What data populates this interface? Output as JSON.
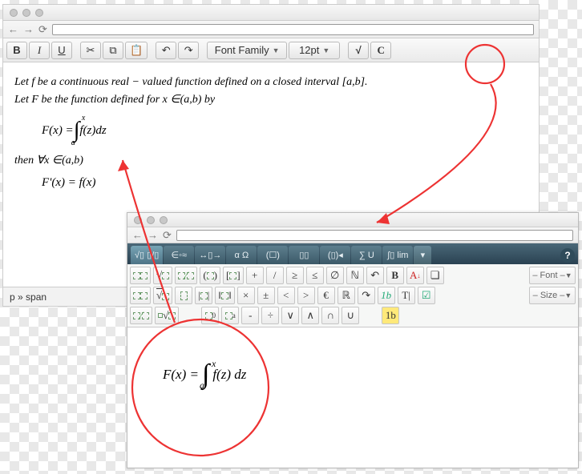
{
  "editor": {
    "toolbar": {
      "bold": "B",
      "italic": "I",
      "underline": "U",
      "font_family_label": "Font Family",
      "font_size_label": "12pt",
      "math_label": "√",
      "clear_label": "C"
    },
    "content": {
      "line1": "Let f be a continuous real − valued function defined on a closed interval [a,b].",
      "line2": "Let F be the function defined for x ∈(a,b) by",
      "eq_lhs": "F(x) =",
      "eq_int_lower": "a",
      "eq_int_upper": "x",
      "eq_rhs": "f(z)dz",
      "line3": "then  ∀x ∈(a,b)",
      "eq2": "F'(x) = f(x)"
    },
    "statusbar": "p » span"
  },
  "math_editor": {
    "tabs": {
      "sqrt_frac": "√▯ ▯/▯",
      "elements": "∈◦≈",
      "arrows": "↔▯→",
      "greek": "α Ω",
      "matrix1": "(☐)",
      "matrix2": "▯▯",
      "bigparen": "(▯)◂",
      "sum": "∑ U",
      "lim": "∫▯ lim",
      "switch": "▾"
    },
    "help": "?",
    "toolbox": {
      "row1": [
        "▯/▯",
        "√▯",
        "▯/▯",
        "(▯)",
        "[▯]",
        "+",
        "/",
        "≥",
        "≤",
        "∅",
        "ℕ",
        "↶",
        "B",
        "A↓",
        "❏",
        "– Font –"
      ],
      "row2": [
        "▯▯",
        "▯/▯",
        "▯▯",
        "|▯|",
        "‖▯‖",
        "×",
        "±",
        "<",
        ">",
        "€",
        "ℝ",
        "↷",
        "1b",
        "T|",
        "☑",
        "▾"
      ],
      "row3": [
        "▯/▯",
        "▯√▯",
        "",
        "▯₀",
        "▯ₐ",
        "-",
        "÷",
        "∨",
        "∧",
        "∩",
        "∪",
        "",
        "1b",
        "",
        "",
        "– Size –",
        "▾"
      ]
    },
    "canvas": {
      "eq_lhs": "F(x) =",
      "eq_int_lower": "a",
      "eq_int_upper": "x",
      "eq_rhs": "f(z) dz"
    }
  },
  "nav": {
    "back": "←",
    "forward": "→",
    "reload": "⟳"
  }
}
